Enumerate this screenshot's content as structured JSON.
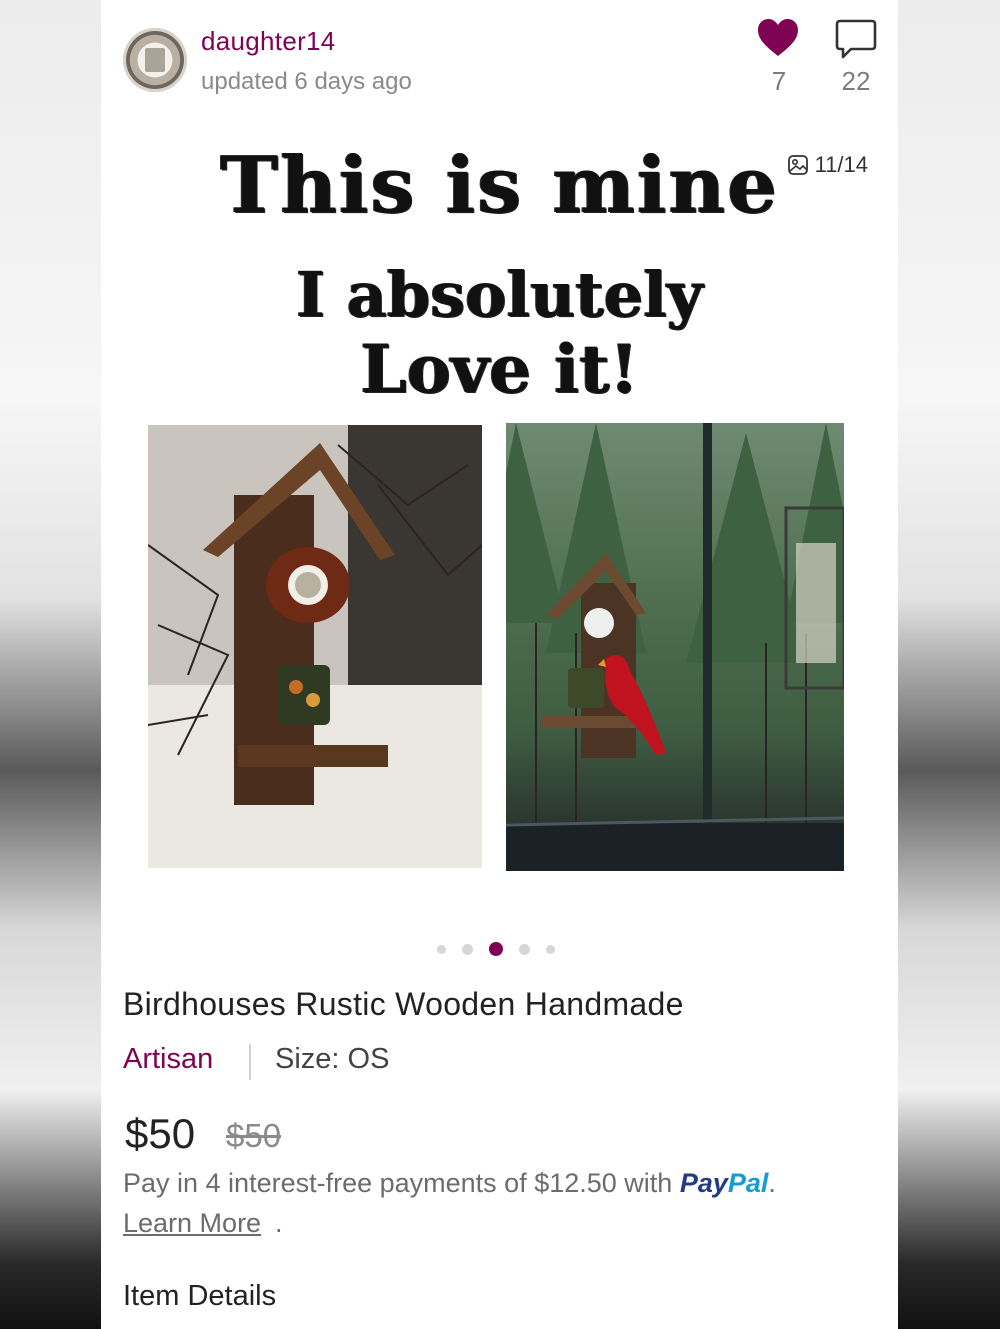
{
  "listing": {
    "username": "daughter14",
    "updated": "updated 6 days ago",
    "like_count": "7",
    "comment_count": "22",
    "image_counter": "11/14",
    "overlay_text": {
      "line1": "This is mine",
      "line2": "I absolutely",
      "line3": "Love it!"
    },
    "carousel": {
      "dots": 5,
      "active_index": 2
    },
    "title": "Birdhouses Rustic Wooden Handmade",
    "brand": "Artisan",
    "size": "Size: OS",
    "price": "$50",
    "original_price": "$50",
    "paypal": {
      "text": "Pay in 4 interest-free payments of $12.50 with",
      "logo_pay": "Pay",
      "logo_pal": "Pal",
      "period": ".",
      "learn_more": "Learn More"
    },
    "learn_more_period": ".",
    "item_details": "Item Details"
  },
  "colors": {
    "accent": "#7f0353",
    "paypal_dark": "#253b80",
    "paypal_light": "#179bd7"
  },
  "icons": {
    "like": "heart-icon",
    "comment": "comment-icon",
    "image_counter": "image-icon"
  }
}
